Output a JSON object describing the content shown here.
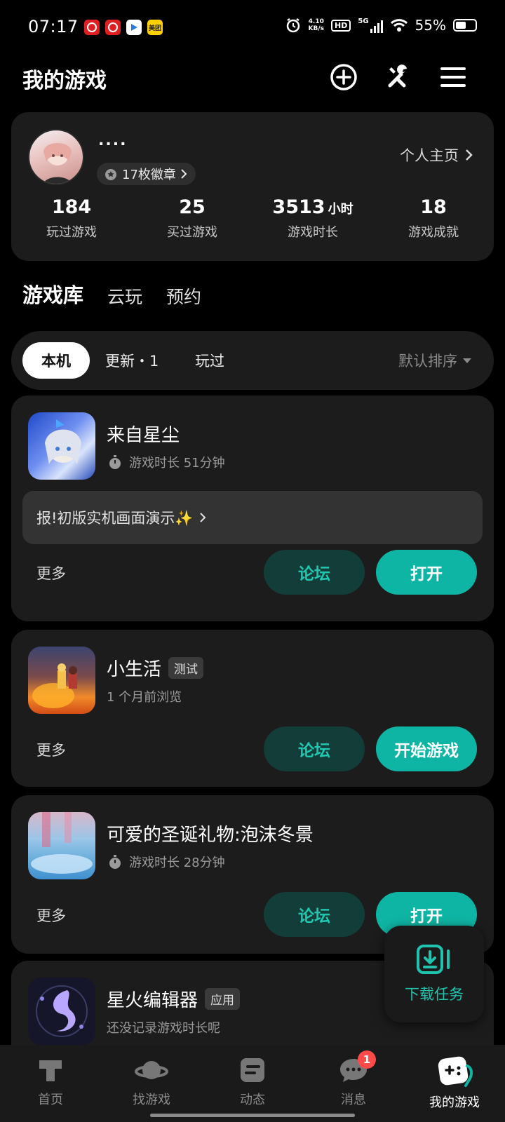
{
  "status_bar": {
    "time": "07:17",
    "net_speed_value": "4.10",
    "net_speed_unit": "KB/s",
    "hd": "HD",
    "network": "5G",
    "battery": "55%",
    "battery_level": 0.55,
    "app_icons": [
      "netease-music-icon",
      "netease-music-icon",
      "video-app-icon",
      "meituan-icon"
    ],
    "app_icon_labels": [
      "",
      "",
      "",
      "美团"
    ]
  },
  "header": {
    "title": "我的游戏",
    "icons": [
      "add-circle-icon",
      "tools-icon",
      "menu-icon"
    ]
  },
  "profile": {
    "username": "....",
    "badges": "17枚徽章",
    "home_link": "个人主页",
    "stats": [
      {
        "value": "184",
        "unit": "",
        "label": "玩过游戏"
      },
      {
        "value": "25",
        "unit": "",
        "label": "买过游戏"
      },
      {
        "value": "3513",
        "unit": "小时",
        "label": "游戏时长"
      },
      {
        "value": "18",
        "unit": "",
        "label": "游戏成就"
      }
    ]
  },
  "tabs": [
    "游戏库",
    "云玩",
    "预约"
  ],
  "filters": {
    "chips": [
      "本机",
      "更新・1",
      "玩过"
    ],
    "sort": "默认排序"
  },
  "games": [
    {
      "title": "来自星尘",
      "tag": "",
      "subtitle": "游戏时长 51分钟",
      "banner": "报!初版实机画面演示✨",
      "more": "更多",
      "forum": "论坛",
      "action": "打开"
    },
    {
      "title": "小生活",
      "tag": "测试",
      "subtitle": "1 个月前浏览",
      "banner": "",
      "more": "更多",
      "forum": "论坛",
      "action": "开始游戏"
    },
    {
      "title": "可爱的圣诞礼物:泡沫冬景",
      "tag": "",
      "subtitle": "游戏时长 28分钟",
      "banner": "",
      "more": "更多",
      "forum": "论坛",
      "action": "打开"
    },
    {
      "title": "星火编辑器",
      "tag": "应用",
      "subtitle": "还没记录游戏时长呢",
      "banner": "",
      "more": "",
      "forum": "",
      "action": ""
    }
  ],
  "download_task": "下载任务",
  "bottom_nav": [
    {
      "label": "首页",
      "icon": "taptap-home-icon"
    },
    {
      "label": "找游戏",
      "icon": "planet-icon"
    },
    {
      "label": "动态",
      "icon": "feed-icon"
    },
    {
      "label": "消息",
      "icon": "chat-icon",
      "badge": "1"
    },
    {
      "label": "我的游戏",
      "icon": "gamepad-icon"
    }
  ],
  "colors": {
    "accent": "#0fb5a4",
    "forum_bg": "#123d39",
    "card_bg": "#1c1c1c",
    "badge_red": "#ff4a4a"
  }
}
